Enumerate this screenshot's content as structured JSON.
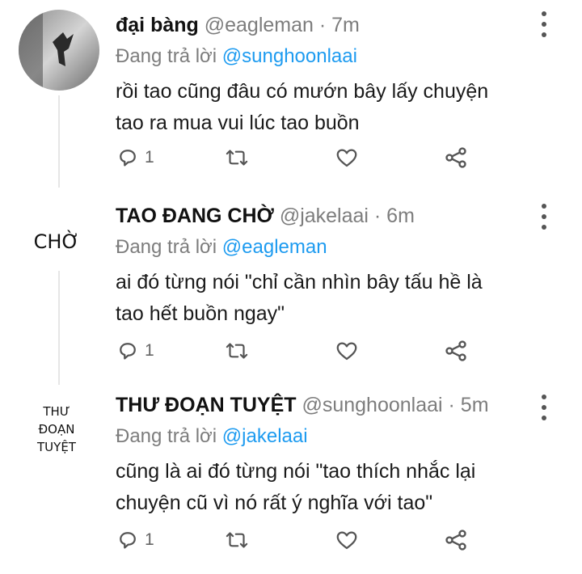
{
  "tweets": [
    {
      "name": "đại bàng",
      "handle": "@eagleman",
      "time": " · 7m",
      "reply_prefix": "Đang trả lời ",
      "reply_to": "@sunghoonlaai",
      "text_lines": [
        "rồi tao cũng đâu có mướn bây lấy chuyện",
        "tao ra mua vui lúc tao buồn"
      ],
      "reply_count": "1",
      "avatar_kind": "eagle-photo"
    },
    {
      "name": "TAO ĐANG CHỜ",
      "handle": "@jakelaai",
      "time": " · 6m",
      "reply_prefix": "Đang trả lời ",
      "reply_to": "@eagleman",
      "text_lines": [
        "ai đó từng nói \"chỉ cần nhìn bây tấu hề là",
        "tao hết buồn ngay\""
      ],
      "reply_count": "1",
      "avatar_text": "CHỜ"
    },
    {
      "name": "THƯ ĐOẠN TUYỆT",
      "handle": "@sunghoonlaai",
      "time": " · 5m",
      "reply_prefix": "Đang trả lời ",
      "reply_to": "@jakelaai",
      "text_lines": [
        "cũng là ai đó từng nói \"tao thích nhắc lại",
        "chuyện cũ vì nó rất ý nghĩa với tao\""
      ],
      "reply_count": "1",
      "avatar_text_lines": [
        "THƯ",
        "ĐOẠN",
        "TUYỆT"
      ]
    }
  ],
  "icons": {
    "reply": "reply-icon",
    "retweet": "retweet-icon",
    "like": "heart-icon",
    "share": "share-icon",
    "more": "more-vertical-icon"
  },
  "colors": {
    "mention": "#1d9bf0",
    "muted": "#7d7d7d",
    "icon": "#555555"
  }
}
